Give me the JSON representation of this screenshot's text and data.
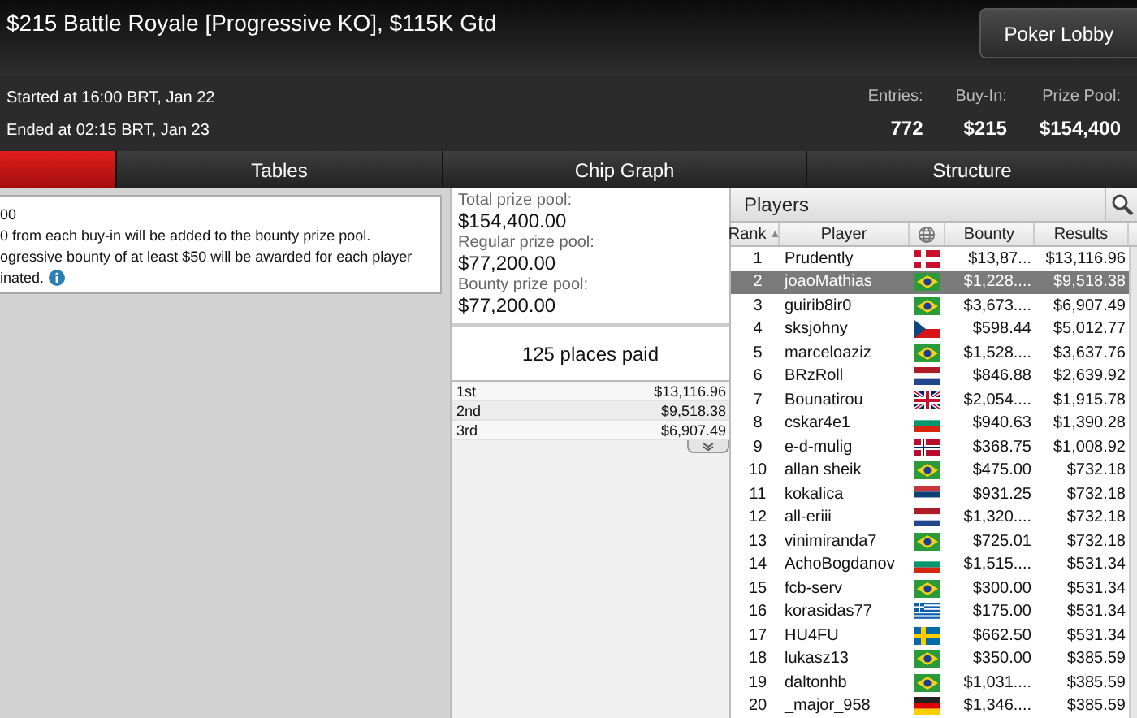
{
  "window": {
    "title": "$215 Battle Royale [Progressive KO], $115K Gtd",
    "lobby_button": "Poker Lobby"
  },
  "times": [
    "Started at 16:00 BRT, Jan 22",
    "Ended at 02:15 BRT, Jan 23"
  ],
  "stats": [
    {
      "label": "Entries:",
      "value": "772"
    },
    {
      "label": "Buy-In:",
      "value": "$215"
    },
    {
      "label": "Prize Pool:",
      "value": "$154,400"
    }
  ],
  "tabs": [
    {
      "selected": true
    },
    {
      "label": "Tables",
      "selected": false
    },
    {
      "label": "Chip Graph",
      "selected": false
    },
    {
      "label": "Structure",
      "selected": false
    }
  ],
  "info_lines": [
    "00",
    "0 from each buy-in will be added to the bounty prize pool.",
    "ogressive bounty of at least $50 will be awarded for each player",
    "inated."
  ],
  "prize_pools": [
    {
      "label": "Total prize pool:",
      "value": "$154,400.00"
    },
    {
      "label": "Regular prize pool:",
      "value": "$77,200.00"
    },
    {
      "label": "Bounty prize pool:",
      "value": "$77,200.00"
    }
  ],
  "places_paid": "125 places paid",
  "payouts": [
    {
      "place": "1st",
      "amount": "$13,116.96"
    },
    {
      "place": "2nd",
      "amount": "$9,518.38"
    },
    {
      "place": "3rd",
      "amount": "$6,907.49"
    }
  ],
  "players": {
    "title": "Players",
    "columns": [
      {
        "label": "Rank",
        "sort": "▲"
      },
      {
        "label": "Player"
      },
      {
        "kind": "globe"
      },
      {
        "label": "Bounty"
      },
      {
        "label": "Results"
      }
    ],
    "rows": [
      {
        "rank": "1",
        "name": "Prudently",
        "kind": "dk",
        "bounty": "$13,87...",
        "result": "$13,116.96",
        "selected": false
      },
      {
        "rank": "2",
        "name": "joaoMathias",
        "kind": "br",
        "bounty": "$1,228....",
        "result": "$9,518.38",
        "selected": true
      },
      {
        "rank": "3",
        "name": "guirib8ir0",
        "kind": "br",
        "bounty": "$3,673....",
        "result": "$6,907.49",
        "selected": false
      },
      {
        "rank": "4",
        "name": "sksjohny",
        "kind": "cz",
        "bounty": "$598.44",
        "result": "$5,012.77",
        "selected": false
      },
      {
        "rank": "5",
        "name": "marceloaziz",
        "kind": "br",
        "bounty": "$1,528....",
        "result": "$3,637.76",
        "selected": false
      },
      {
        "rank": "6",
        "name": "BRzRoll",
        "kind": "nl",
        "bounty": "$846.88",
        "result": "$2,639.92",
        "selected": false
      },
      {
        "rank": "7",
        "name": "Bounatirou",
        "kind": "gb",
        "bounty": "$2,054....",
        "result": "$1,915.78",
        "selected": false
      },
      {
        "rank": "8",
        "name": "cskar4e1",
        "kind": "bg",
        "bounty": "$940.63",
        "result": "$1,390.28",
        "selected": false
      },
      {
        "rank": "9",
        "name": "e-d-mulig",
        "kind": "no",
        "bounty": "$368.75",
        "result": "$1,008.92",
        "selected": false
      },
      {
        "rank": "10",
        "name": "allan sheik",
        "kind": "br",
        "bounty": "$475.00",
        "result": "$732.18",
        "selected": false
      },
      {
        "rank": "11",
        "name": "kokalica",
        "kind": "rs",
        "bounty": "$931.25",
        "result": "$732.18",
        "selected": false
      },
      {
        "rank": "12",
        "name": "all-eriii",
        "kind": "nl",
        "bounty": "$1,320....",
        "result": "$732.18",
        "selected": false
      },
      {
        "rank": "13",
        "name": "vinimiranda7",
        "kind": "br",
        "bounty": "$725.01",
        "result": "$732.18",
        "selected": false
      },
      {
        "rank": "14",
        "name": "AchoBogdanov",
        "kind": "bg",
        "bounty": "$1,515....",
        "result": "$531.34",
        "selected": false
      },
      {
        "rank": "15",
        "name": "fcb-serv",
        "kind": "br",
        "bounty": "$300.00",
        "result": "$531.34",
        "selected": false
      },
      {
        "rank": "16",
        "name": "korasidas77",
        "kind": "gr",
        "bounty": "$175.00",
        "result": "$531.34",
        "selected": false
      },
      {
        "rank": "17",
        "name": "HU4FU",
        "kind": "se",
        "bounty": "$662.50",
        "result": "$531.34",
        "selected": false
      },
      {
        "rank": "18",
        "name": "lukasz13",
        "kind": "br",
        "bounty": "$350.00",
        "result": "$385.59",
        "selected": false
      },
      {
        "rank": "19",
        "name": "daltonhb",
        "kind": "br",
        "bounty": "$1,031....",
        "result": "$385.59",
        "selected": false
      },
      {
        "rank": "20",
        "name": "_major_958",
        "kind": "de",
        "bounty": "$1,346....",
        "result": "$385.59",
        "selected": false
      }
    ]
  }
}
